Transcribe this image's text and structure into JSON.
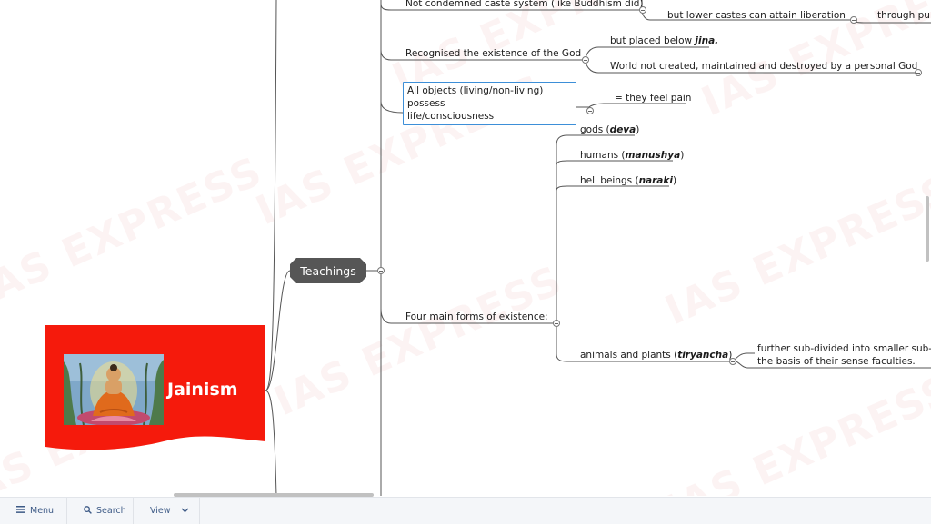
{
  "watermark": "IAS EXPRESS",
  "central": {
    "title": "Jainism",
    "image_icon": "buddha-image"
  },
  "topic": {
    "label": "Teachings"
  },
  "branches": {
    "caste": {
      "label": "Not condemned caste system (like Buddhism did)",
      "child": "but lower castes can attain liberation",
      "grandchild": "through pu"
    },
    "god": {
      "label": "Recognised the existence of the God",
      "child1_pre": "but placed below ",
      "child1_em": "jina.",
      "child2": "World not created, maintained and destroyed by a personal God"
    },
    "objects": {
      "line1": "All objects (living/non-living) possess",
      "line2": "life/consciousness",
      "child": "= they feel pain"
    },
    "forms": {
      "label": "Four main forms of existence:",
      "items": [
        {
          "pre": "gods (",
          "em": "deva",
          "post": ")"
        },
        {
          "pre": "humans (",
          "em": "manushya",
          "post": ")"
        },
        {
          "pre": "hell beings (",
          "em": "naraki",
          "post": ")"
        },
        {
          "pre": "animals and plants (",
          "em": "tiryancha",
          "post": ")"
        }
      ],
      "sub_line1": "further sub-divided into smaller sub-c",
      "sub_line2": "the basis of their sense faculties."
    }
  },
  "bottom_bar": {
    "menu": "Menu",
    "menu_icon": "hamburger-icon",
    "search": "Search",
    "search_icon": "search-icon",
    "view": "View",
    "view_icon": "chevron-down-icon"
  },
  "colors": {
    "central_bg": "#f51a0c",
    "topic_bg": "#565656",
    "selected_border": "#3d8fd8",
    "toolbar_text": "#3d5a86"
  }
}
